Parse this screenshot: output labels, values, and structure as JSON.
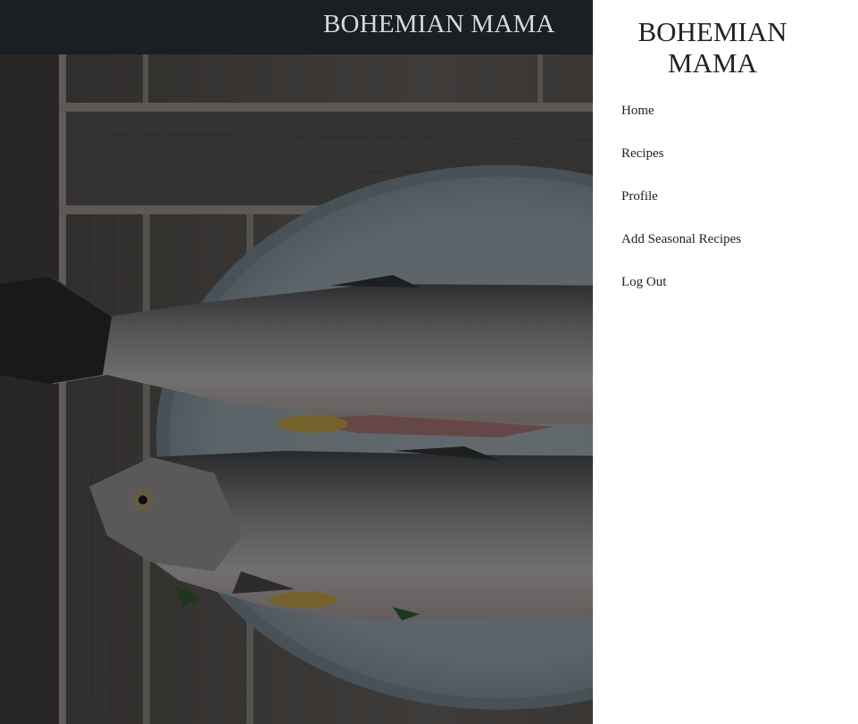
{
  "header": {
    "brand": "BOHEMIAN MAMA"
  },
  "hero": {
    "image": "trout-on-plate-photo"
  },
  "drawer": {
    "brand_line1": "BOHEMIAN",
    "brand_line2": "MAMA",
    "nav": [
      {
        "label": "Home"
      },
      {
        "label": "Recipes"
      },
      {
        "label": "Profile"
      },
      {
        "label": "Add Seasonal Recipes"
      },
      {
        "label": "Log Out"
      }
    ]
  },
  "colors": {
    "topbar": "#353e47",
    "drawer_bg": "#ffffff",
    "text": "#222222"
  }
}
